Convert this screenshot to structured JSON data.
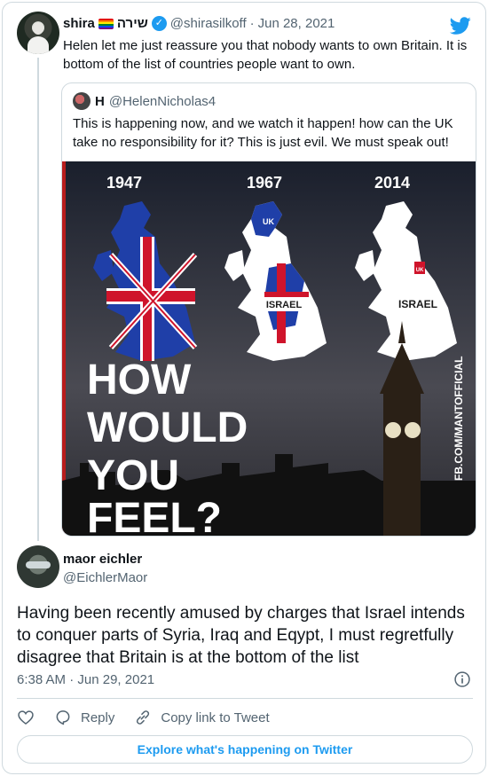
{
  "parent": {
    "name": "shira",
    "name_suffix": "שירה",
    "handle": "@shirasilkoff",
    "separator": "·",
    "date": "Jun 28, 2021",
    "text": "Helen let me just reassure you that nobody wants to own Britain. It is bottom of the list of countries people want to own."
  },
  "quoted": {
    "name": "H",
    "handle": "@HelenNicholas4",
    "text": "This is happening now, and we watch it happen! how can the UK take no responsibility for it? This is just evil. We must speak out!",
    "image": {
      "years": [
        "1947",
        "1967",
        "2014"
      ],
      "map_labels": {
        "uk_1967": "UK",
        "israel_1967": "ISRAEL",
        "uk_2014": "UK",
        "israel_2014": "ISRAEL"
      },
      "headline": [
        "HOW",
        "WOULD",
        "YOU",
        "FEEL?"
      ],
      "side_credit": "FB.COM/MANTOFFICIAL"
    }
  },
  "reply": {
    "name": "maor eichler",
    "handle": "@EichlerMaor",
    "text": "Having been recently amused by charges that Israel intends to conquer parts of Syria, Iraq and Eqypt, I must regretfully disagree that Britain is at the bottom of the list",
    "time": "6:38 AM",
    "separator": "·",
    "date": "Jun 29, 2021"
  },
  "actions": {
    "like_icon": "heart-icon",
    "reply_label": "Reply",
    "copy_link_label": "Copy link to Tweet"
  },
  "explore_label": "Explore what's happening on Twitter",
  "colors": {
    "accent": "#1d9bf0",
    "muted": "#536471",
    "border": "#cfd9de"
  }
}
